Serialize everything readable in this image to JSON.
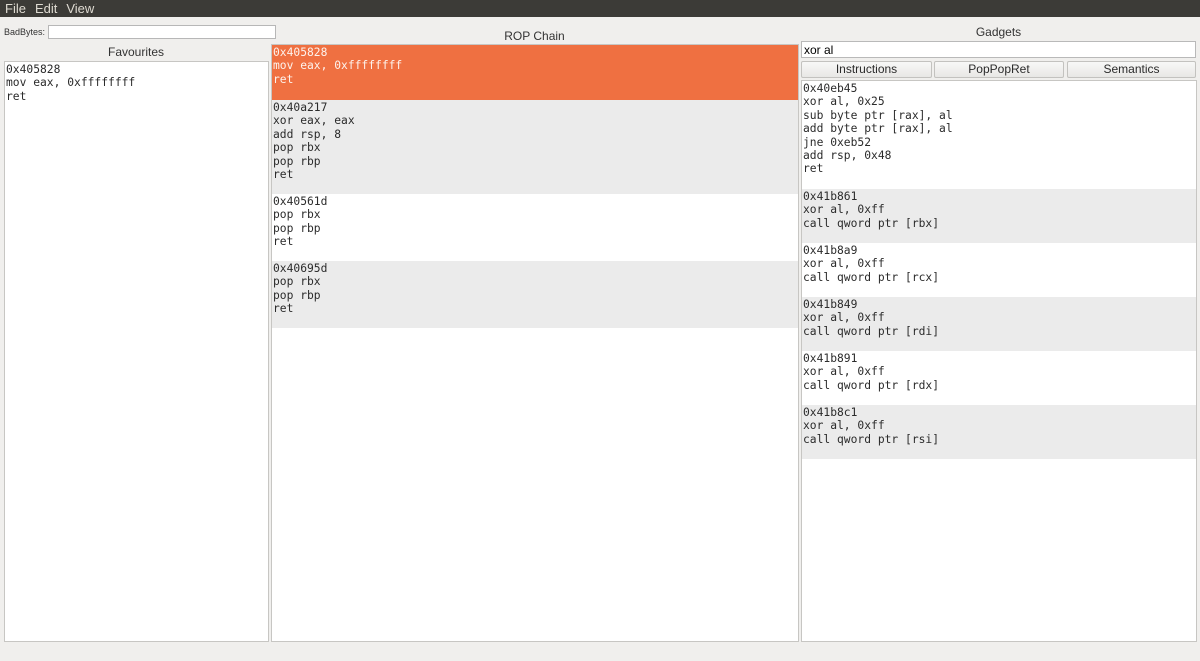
{
  "menu": {
    "items": [
      "File",
      "Edit",
      "View"
    ]
  },
  "badbytes": {
    "label": "BadBytes:",
    "value": ""
  },
  "favourites": {
    "title": "Favourites",
    "items": [
      {
        "lines": [
          "0x405828",
          "mov eax, 0xffffffff",
          "ret"
        ]
      }
    ]
  },
  "rop_chain": {
    "title": "ROP Chain",
    "items": [
      {
        "lines": [
          "0x405828",
          "mov eax, 0xffffffff",
          "ret"
        ],
        "selected": true
      },
      {
        "lines": [
          "0x40a217",
          "xor eax, eax",
          "add rsp, 8",
          "pop rbx",
          "pop rbp",
          "ret"
        ]
      },
      {
        "lines": [
          "0x40561d",
          "pop rbx",
          "pop rbp",
          "ret"
        ]
      },
      {
        "lines": [
          "0x40695d",
          "pop rbx",
          "pop rbp",
          "ret"
        ]
      }
    ]
  },
  "gadgets": {
    "title": "Gadgets",
    "search_value": "xor al",
    "buttons": [
      "Instructions",
      "PopPopRet",
      "Semantics"
    ],
    "items": [
      {
        "lines": [
          "0x40eb45",
          "xor al, 0x25",
          "sub byte ptr [rax], al",
          "add byte ptr [rax], al",
          "jne 0xeb52",
          "add rsp, 0x48",
          "ret"
        ]
      },
      {
        "lines": [
          "0x41b861",
          "xor al, 0xff",
          "call qword ptr [rbx]"
        ]
      },
      {
        "lines": [
          "0x41b8a9",
          "xor al, 0xff",
          "call qword ptr [rcx]"
        ]
      },
      {
        "lines": [
          "0x41b849",
          "xor al, 0xff",
          "call qword ptr [rdi]"
        ]
      },
      {
        "lines": [
          "0x41b891",
          "xor al, 0xff",
          "call qword ptr [rdx]"
        ]
      },
      {
        "lines": [
          "0x41b8c1",
          "xor al, 0xff",
          "call qword ptr [rsi]"
        ]
      }
    ]
  },
  "colors": {
    "selection": "#ef7041",
    "alt_row": "#ebebeb",
    "menubar": "#3c3b37"
  }
}
